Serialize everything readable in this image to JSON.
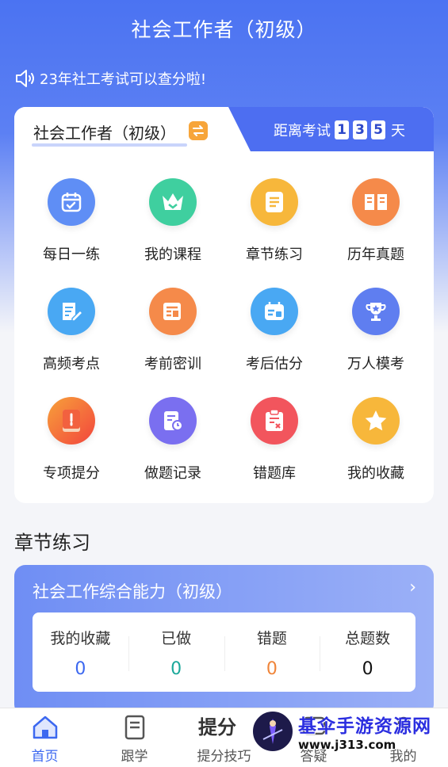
{
  "header": {
    "title": "社会工作者（初级）"
  },
  "notice": {
    "text": "23年社工考试可以查分啦!"
  },
  "exam_card": {
    "tab_title": "社会工作者（初级）",
    "countdown_label": "距离考试",
    "days_digits": [
      "1",
      "3",
      "5"
    ],
    "days_unit": "天"
  },
  "grid": [
    {
      "label": "每日一练",
      "icon": "calendar-check-icon",
      "color": "#5f8ef5"
    },
    {
      "label": "我的课程",
      "icon": "crown-icon",
      "color": "#3fcf9f"
    },
    {
      "label": "章节练习",
      "icon": "document-icon",
      "color": "#f7b73b"
    },
    {
      "label": "历年真题",
      "icon": "open-book-icon",
      "color": "#f58a4a"
    },
    {
      "label": "高频考点",
      "icon": "edit-note-icon",
      "color": "#49a8f3"
    },
    {
      "label": "考前密训",
      "icon": "newspaper-icon",
      "color": "#f58a4a"
    },
    {
      "label": "考后估分",
      "icon": "calendar-estimate-icon",
      "color": "#49a8f3"
    },
    {
      "label": "万人模考",
      "icon": "trophy-icon",
      "color": "#5f7ef0"
    },
    {
      "label": "专项提分",
      "icon": "notebook-icon",
      "color": "#f5673f"
    },
    {
      "label": "做题记录",
      "icon": "record-clock-icon",
      "color": "#7a6ff0"
    },
    {
      "label": "错题库",
      "icon": "clipboard-error-icon",
      "color": "#f2555d"
    },
    {
      "label": "我的收藏",
      "icon": "star-icon",
      "color": "#f7b73b"
    }
  ],
  "section": {
    "title": "章节练习"
  },
  "chapter": {
    "title": "社会工作综合能力（初级）",
    "stats": [
      {
        "label": "我的收藏",
        "value": "0",
        "color": "#3c68f0"
      },
      {
        "label": "已做",
        "value": "0",
        "color": "#1aa89a"
      },
      {
        "label": "错题",
        "value": "0",
        "color": "#f0853a"
      },
      {
        "label": "总题数",
        "value": "0",
        "color": "#111111"
      }
    ]
  },
  "tabbar": [
    {
      "label": "首页",
      "icon": "home-icon",
      "active": true
    },
    {
      "label": "跟学",
      "icon": "book-icon",
      "active": false
    },
    {
      "label": "提分技巧",
      "icon": "tifen-logo-icon",
      "active": false
    },
    {
      "label": "答疑",
      "icon": "qa-icon",
      "active": false
    },
    {
      "label": "我的",
      "icon": "user-icon",
      "active": false
    }
  ],
  "watermark": {
    "line1": "基伞手游资源网",
    "line2": "www.j313.com"
  },
  "tifen_logo": {
    "text": "提分"
  }
}
